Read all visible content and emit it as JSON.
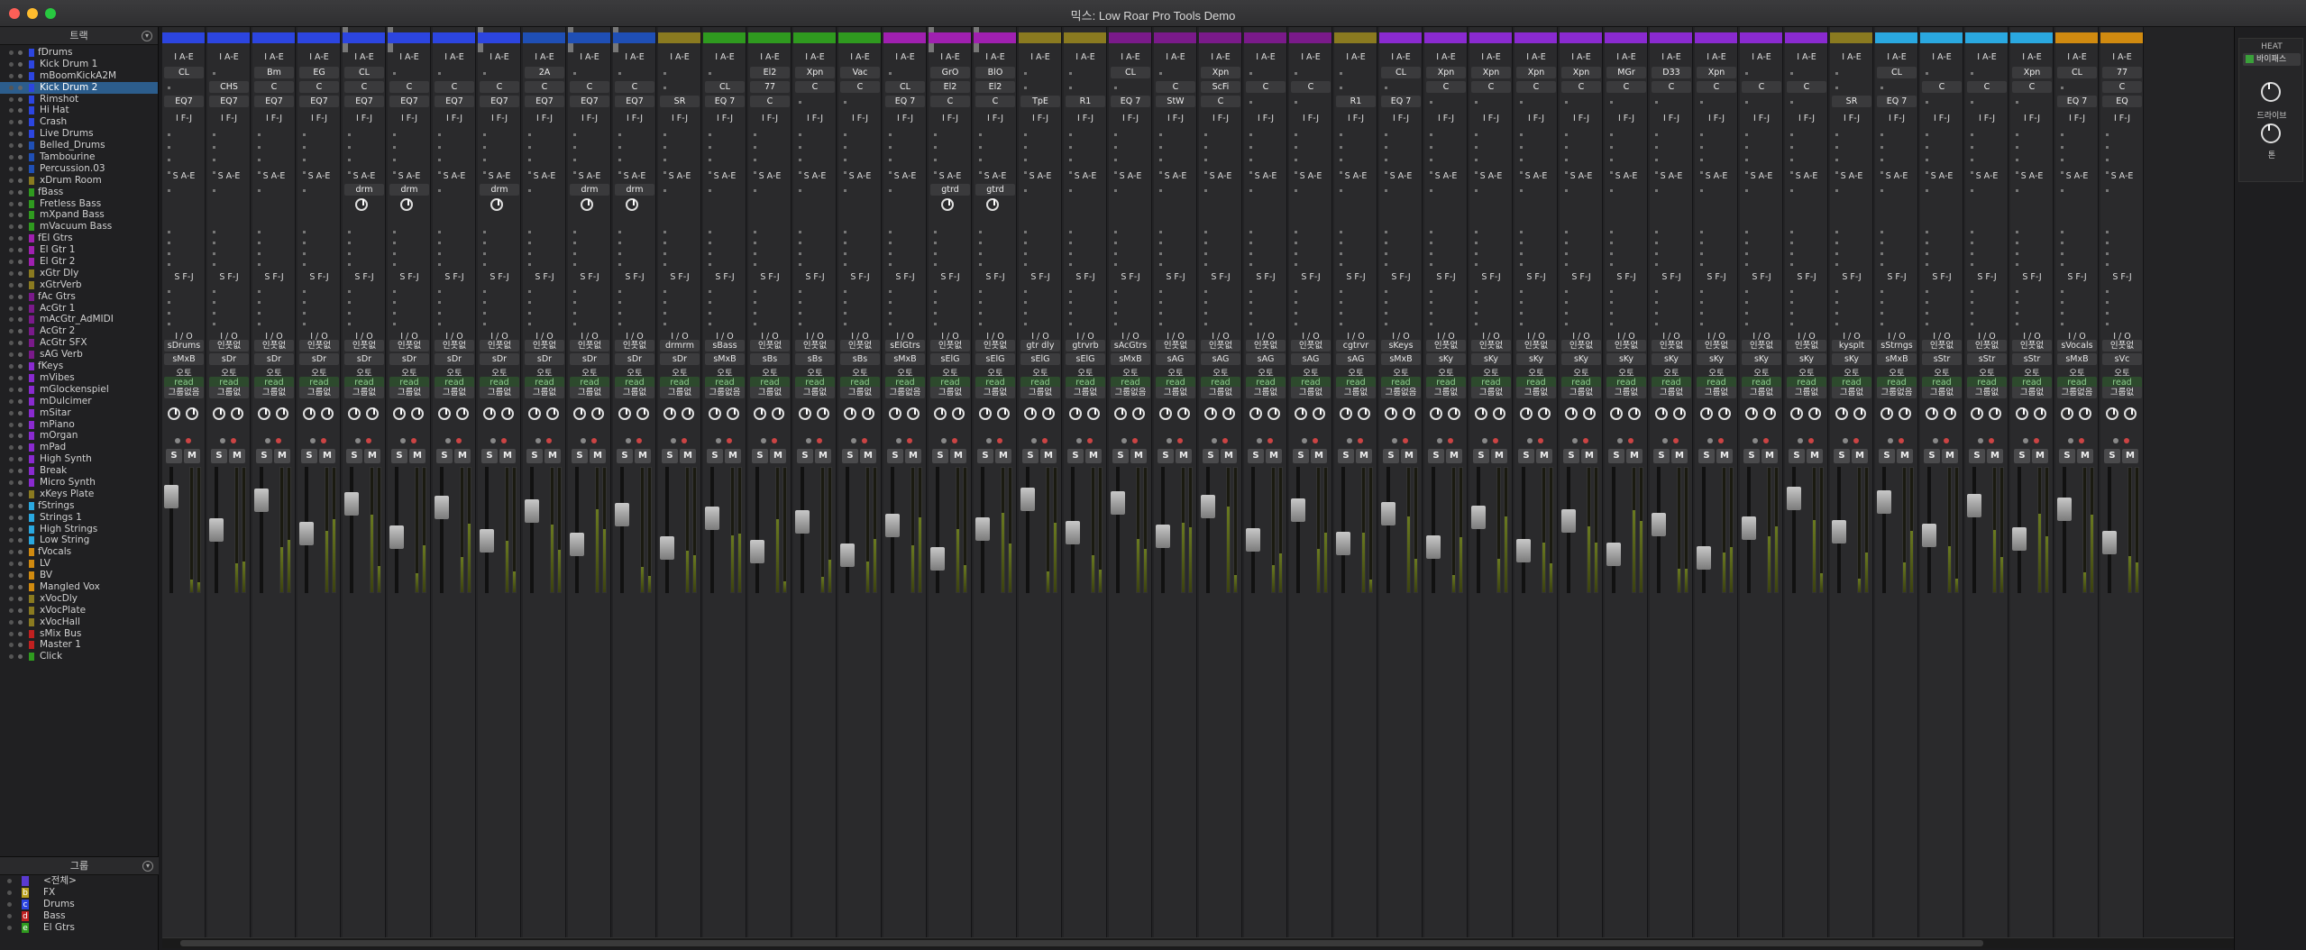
{
  "window": {
    "title": "믹스: Low Roar Pro Tools Demo"
  },
  "tracks_panel": {
    "title": "트랙",
    "items": [
      {
        "label": "fDrums",
        "color": "#2c45e0",
        "sel": false
      },
      {
        "label": "Kick Drum 1",
        "color": "#2c45e0",
        "sel": false
      },
      {
        "label": "mBoomKickA2M",
        "color": "#2c45e0",
        "sel": false
      },
      {
        "label": "Kick Drum 2",
        "color": "#2c45e0",
        "sel": true
      },
      {
        "label": "Rimshot",
        "color": "#2c45e0",
        "sel": false
      },
      {
        "label": "Hi Hat",
        "color": "#2c45e0",
        "sel": false
      },
      {
        "label": "Crash",
        "color": "#2c45e0",
        "sel": false
      },
      {
        "label": "Live Drums",
        "color": "#2c45e0",
        "sel": false
      },
      {
        "label": "Belled_Drums",
        "color": "#1f4fb5",
        "sel": false
      },
      {
        "label": "Tambourine",
        "color": "#1f4fb5",
        "sel": false
      },
      {
        "label": "Percussion.03",
        "color": "#1f4fb5",
        "sel": false
      },
      {
        "label": "xDrum Room",
        "color": "#8a7a20",
        "sel": false
      },
      {
        "label": "fBass",
        "color": "#2f9a1f",
        "sel": false
      },
      {
        "label": "Fretless Bass",
        "color": "#2f9a1f",
        "sel": false
      },
      {
        "label": "mXpand Bass",
        "color": "#2f9a1f",
        "sel": false
      },
      {
        "label": "mVacuum Bass",
        "color": "#2f9a1f",
        "sel": false
      },
      {
        "label": "fEl Gtrs",
        "color": "#a020b0",
        "sel": false
      },
      {
        "label": "El Gtr 1",
        "color": "#a020b0",
        "sel": false
      },
      {
        "label": "El Gtr 2",
        "color": "#a020b0",
        "sel": false
      },
      {
        "label": "xGtr Dly",
        "color": "#8a7a20",
        "sel": false
      },
      {
        "label": "xGtrVerb",
        "color": "#8a7a20",
        "sel": false
      },
      {
        "label": "fAc Gtrs",
        "color": "#7a1a8a",
        "sel": false
      },
      {
        "label": "AcGtr 1",
        "color": "#7a1a8a",
        "sel": false
      },
      {
        "label": "mAcGtr_AdMIDI",
        "color": "#7a1a8a",
        "sel": false
      },
      {
        "label": "AcGtr 2",
        "color": "#7a1a8a",
        "sel": false
      },
      {
        "label": "AcGtr SFX",
        "color": "#7a1a8a",
        "sel": false
      },
      {
        "label": "sAG Verb",
        "color": "#7a1a8a",
        "sel": false
      },
      {
        "label": "fKeys",
        "color": "#8a2ad0",
        "sel": false
      },
      {
        "label": "mVibes",
        "color": "#8a2ad0",
        "sel": false
      },
      {
        "label": "mGlockenspiel",
        "color": "#8a2ad0",
        "sel": false
      },
      {
        "label": "mDulcimer",
        "color": "#8a2ad0",
        "sel": false
      },
      {
        "label": "mSitar",
        "color": "#8a2ad0",
        "sel": false
      },
      {
        "label": "mPiano",
        "color": "#8a2ad0",
        "sel": false
      },
      {
        "label": "mOrgan",
        "color": "#8a2ad0",
        "sel": false
      },
      {
        "label": "mPad",
        "color": "#8a2ad0",
        "sel": false
      },
      {
        "label": "High Synth",
        "color": "#8a2ad0",
        "sel": false
      },
      {
        "label": "Break",
        "color": "#8a2ad0",
        "sel": false
      },
      {
        "label": "Micro Synth",
        "color": "#8a2ad0",
        "sel": false
      },
      {
        "label": "xKeys Plate",
        "color": "#8a7a20",
        "sel": false
      },
      {
        "label": "fStrings",
        "color": "#2aa8e0",
        "sel": false
      },
      {
        "label": "Strings 1",
        "color": "#2aa8e0",
        "sel": false
      },
      {
        "label": "High Strings",
        "color": "#2aa8e0",
        "sel": false
      },
      {
        "label": "Low String",
        "color": "#2aa8e0",
        "sel": false
      },
      {
        "label": "fVocals",
        "color": "#d08a10",
        "sel": false
      },
      {
        "label": "LV",
        "color": "#d08a10",
        "sel": false
      },
      {
        "label": "BV",
        "color": "#d08a10",
        "sel": false
      },
      {
        "label": "Mangled Vox",
        "color": "#d08a10",
        "sel": false
      },
      {
        "label": "xVocDly",
        "color": "#8a7a20",
        "sel": false
      },
      {
        "label": "xVocPlate",
        "color": "#8a7a20",
        "sel": false
      },
      {
        "label": "xVocHall",
        "color": "#8a7a20",
        "sel": false
      },
      {
        "label": "sMix Bus",
        "color": "#c02020",
        "sel": false
      },
      {
        "label": "Master 1",
        "color": "#c02020",
        "sel": false
      },
      {
        "label": "Click",
        "color": "#2f9a1f",
        "sel": false
      }
    ]
  },
  "groups_panel": {
    "title": "그룹",
    "items": [
      {
        "letter": "",
        "label": "<전체>",
        "color": "#5a3ad0"
      },
      {
        "letter": "b",
        "label": "FX",
        "color": "#b8a020"
      },
      {
        "letter": "c",
        "label": "Drums",
        "color": "#2c45e0"
      },
      {
        "letter": "d",
        "label": "Bass",
        "color": "#c02020"
      },
      {
        "letter": "e",
        "label": "El Gtrs",
        "color": "#2f9a1f"
      }
    ]
  },
  "mixer": {
    "insert_header": "I A-E",
    "insert_header2": "I F-J",
    "send_header": "S A-E",
    "send_header2": "S F-J",
    "io_label": "I / O",
    "auto_label": "오토",
    "read_label": "read",
    "group_label": "그룹없",
    "group_label_long": "그룹없음",
    "solo_label": "S",
    "mute_label": "M",
    "strips": [
      {
        "color": "#2c45e0",
        "ins": [
          "CL",
          "",
          "EQ7"
        ],
        "out": "sDrums",
        "in": "sMxB",
        "send": ""
      },
      {
        "color": "#2c45e0",
        "ins": [
          "",
          "CHS",
          "EQ7"
        ],
        "out": "인풋없",
        "in": "sDr",
        "send": ""
      },
      {
        "color": "#2c45e0",
        "ins": [
          "Bm",
          "C",
          "EQ7"
        ],
        "out": "인풋없",
        "in": "sDr",
        "send": ""
      },
      {
        "color": "#2c45e0",
        "ins": [
          "EG",
          "C",
          "EQ7"
        ],
        "out": "인풋없",
        "in": "sDr",
        "send": ""
      },
      {
        "color": "#2c45e0",
        "ins": [
          "CL",
          "C",
          "EQ7"
        ],
        "out": "인풋없",
        "in": "sDr",
        "send": "drm"
      },
      {
        "color": "#2c45e0",
        "ins": [
          "",
          "C",
          "EQ7"
        ],
        "out": "인풋없",
        "in": "sDr",
        "send": "drm"
      },
      {
        "color": "#2c45e0",
        "ins": [
          "",
          "C",
          "EQ7"
        ],
        "out": "인풋없",
        "in": "sDr",
        "send": ""
      },
      {
        "color": "#2c45e0",
        "ins": [
          "",
          "C",
          "EQ7"
        ],
        "out": "인풋없",
        "in": "sDr",
        "send": "drm"
      },
      {
        "color": "#1f4fb5",
        "ins": [
          "2A",
          "C",
          "EQ7"
        ],
        "out": "인풋없",
        "in": "sDr",
        "send": ""
      },
      {
        "color": "#1f4fb5",
        "ins": [
          "",
          "C",
          "EQ7"
        ],
        "out": "인풋없",
        "in": "sDr",
        "send": "drm"
      },
      {
        "color": "#1f4fb5",
        "ins": [
          "",
          "C",
          "EQ7"
        ],
        "out": "인풋없",
        "in": "sDr",
        "send": "drm"
      },
      {
        "color": "#8a7a20",
        "ins": [
          "",
          "",
          "SR"
        ],
        "out": "drmrm",
        "in": "sDr",
        "send": ""
      },
      {
        "color": "#2f9a1f",
        "ins": [
          "",
          "CL",
          "EQ 7"
        ],
        "out": "sBass",
        "in": "sMxB",
        "send": ""
      },
      {
        "color": "#2f9a1f",
        "ins": [
          "El2",
          "77",
          "C"
        ],
        "out": "인풋없",
        "in": "sBs",
        "send": ""
      },
      {
        "color": "#2f9a1f",
        "ins": [
          "Xpn",
          "C",
          ""
        ],
        "out": "인풋없",
        "in": "sBs",
        "send": ""
      },
      {
        "color": "#2f9a1f",
        "ins": [
          "Vac",
          "C",
          ""
        ],
        "out": "인풋없",
        "in": "sBs",
        "send": ""
      },
      {
        "color": "#a020b0",
        "ins": [
          "",
          "CL",
          "EQ 7"
        ],
        "out": "sElGtrs",
        "in": "sMxB",
        "send": ""
      },
      {
        "color": "#a020b0",
        "ins": [
          "GrO",
          "El2",
          "C"
        ],
        "out": "인풋없",
        "in": "sElG",
        "send": "gtrd"
      },
      {
        "color": "#a020b0",
        "ins": [
          "BlO",
          "El2",
          "C"
        ],
        "out": "인풋없",
        "in": "sElG",
        "send": "gtrd"
      },
      {
        "color": "#8a7a20",
        "ins": [
          "",
          "",
          "TpE"
        ],
        "out": "gtr dly",
        "in": "sElG",
        "send": ""
      },
      {
        "color": "#8a7a20",
        "ins": [
          "",
          "",
          "R1"
        ],
        "out": "gtrvrb",
        "in": "sElG",
        "send": ""
      },
      {
        "color": "#7a1a8a",
        "ins": [
          "CL",
          "",
          "EQ 7"
        ],
        "out": "sAcGtrs",
        "in": "sMxB",
        "send": ""
      },
      {
        "color": "#7a1a8a",
        "ins": [
          "",
          "C",
          "StW"
        ],
        "out": "인풋없",
        "in": "sAG",
        "send": ""
      },
      {
        "color": "#7a1a8a",
        "ins": [
          "Xpn",
          "ScFi",
          "C"
        ],
        "out": "인풋없",
        "in": "sAG",
        "send": ""
      },
      {
        "color": "#7a1a8a",
        "ins": [
          "",
          "C",
          ""
        ],
        "out": "인풋없",
        "in": "sAG",
        "send": ""
      },
      {
        "color": "#7a1a8a",
        "ins": [
          "",
          "C",
          ""
        ],
        "out": "인풋없",
        "in": "sAG",
        "send": ""
      },
      {
        "color": "#8a7a20",
        "ins": [
          "",
          "",
          "R1"
        ],
        "out": "cgtrvr",
        "in": "sAG",
        "send": ""
      },
      {
        "color": "#8a2ad0",
        "ins": [
          "CL",
          "",
          "EQ 7"
        ],
        "out": "sKeys",
        "in": "sMxB",
        "send": ""
      },
      {
        "color": "#8a2ad0",
        "ins": [
          "Xpn",
          "C",
          ""
        ],
        "out": "인풋없",
        "in": "sKy",
        "send": ""
      },
      {
        "color": "#8a2ad0",
        "ins": [
          "Xpn",
          "C",
          ""
        ],
        "out": "인풋없",
        "in": "sKy",
        "send": ""
      },
      {
        "color": "#8a2ad0",
        "ins": [
          "Xpn",
          "C",
          ""
        ],
        "out": "인풋없",
        "in": "sKy",
        "send": ""
      },
      {
        "color": "#8a2ad0",
        "ins": [
          "Xpn",
          "C",
          ""
        ],
        "out": "인풋없",
        "in": "sKy",
        "send": ""
      },
      {
        "color": "#8a2ad0",
        "ins": [
          "MGr",
          "C",
          ""
        ],
        "out": "인풋없",
        "in": "sKy",
        "send": ""
      },
      {
        "color": "#8a2ad0",
        "ins": [
          "D33",
          "C",
          ""
        ],
        "out": "인풋없",
        "in": "sKy",
        "send": ""
      },
      {
        "color": "#8a2ad0",
        "ins": [
          "Xpn",
          "C",
          ""
        ],
        "out": "인풋없",
        "in": "sKy",
        "send": ""
      },
      {
        "color": "#8a2ad0",
        "ins": [
          "",
          "C",
          ""
        ],
        "out": "인풋없",
        "in": "sKy",
        "send": ""
      },
      {
        "color": "#8a2ad0",
        "ins": [
          "",
          "C",
          ""
        ],
        "out": "인풋없",
        "in": "sKy",
        "send": ""
      },
      {
        "color": "#8a7a20",
        "ins": [
          "",
          "",
          "SR"
        ],
        "out": "kysplt",
        "in": "sKy",
        "send": ""
      },
      {
        "color": "#2aa8e0",
        "ins": [
          "CL",
          "",
          "EQ 7"
        ],
        "out": "sStrngs",
        "in": "sMxB",
        "send": ""
      },
      {
        "color": "#2aa8e0",
        "ins": [
          "",
          "C",
          ""
        ],
        "out": "인풋없",
        "in": "sStr",
        "send": ""
      },
      {
        "color": "#2aa8e0",
        "ins": [
          "",
          "C",
          ""
        ],
        "out": "인풋없",
        "in": "sStr",
        "send": ""
      },
      {
        "color": "#2aa8e0",
        "ins": [
          "Xpn",
          "C",
          ""
        ],
        "out": "인풋없",
        "in": "sStr",
        "send": ""
      },
      {
        "color": "#d08a10",
        "ins": [
          "CL",
          "",
          "EQ 7"
        ],
        "out": "sVocals",
        "in": "sMxB",
        "send": ""
      },
      {
        "color": "#d08a10",
        "ins": [
          "77",
          "C",
          "EQ"
        ],
        "out": "인풋없",
        "in": "sVc",
        "send": ""
      }
    ]
  },
  "right_panel": {
    "heat_title": "HEAT",
    "bypass_label": "바이패스",
    "drive_label": "드라이브",
    "tone_label": "톤"
  }
}
